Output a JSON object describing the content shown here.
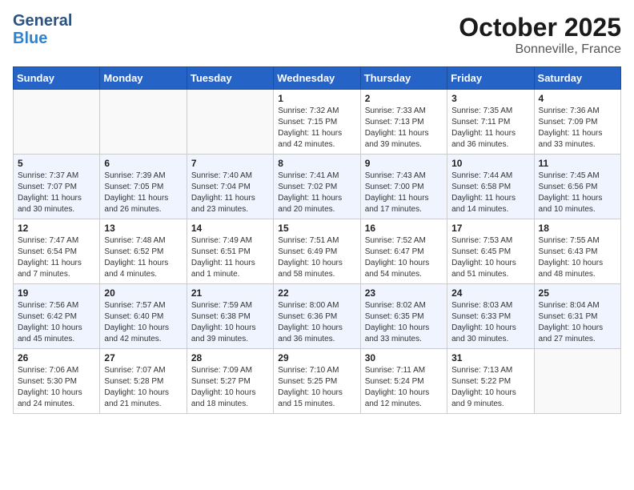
{
  "header": {
    "logo_line1": "General",
    "logo_line2": "Blue",
    "month": "October 2025",
    "location": "Bonneville, France"
  },
  "weekdays": [
    "Sunday",
    "Monday",
    "Tuesday",
    "Wednesday",
    "Thursday",
    "Friday",
    "Saturday"
  ],
  "weeks": [
    [
      {
        "day": "",
        "info": ""
      },
      {
        "day": "",
        "info": ""
      },
      {
        "day": "",
        "info": ""
      },
      {
        "day": "1",
        "info": "Sunrise: 7:32 AM\nSunset: 7:15 PM\nDaylight: 11 hours\nand 42 minutes."
      },
      {
        "day": "2",
        "info": "Sunrise: 7:33 AM\nSunset: 7:13 PM\nDaylight: 11 hours\nand 39 minutes."
      },
      {
        "day": "3",
        "info": "Sunrise: 7:35 AM\nSunset: 7:11 PM\nDaylight: 11 hours\nand 36 minutes."
      },
      {
        "day": "4",
        "info": "Sunrise: 7:36 AM\nSunset: 7:09 PM\nDaylight: 11 hours\nand 33 minutes."
      }
    ],
    [
      {
        "day": "5",
        "info": "Sunrise: 7:37 AM\nSunset: 7:07 PM\nDaylight: 11 hours\nand 30 minutes."
      },
      {
        "day": "6",
        "info": "Sunrise: 7:39 AM\nSunset: 7:05 PM\nDaylight: 11 hours\nand 26 minutes."
      },
      {
        "day": "7",
        "info": "Sunrise: 7:40 AM\nSunset: 7:04 PM\nDaylight: 11 hours\nand 23 minutes."
      },
      {
        "day": "8",
        "info": "Sunrise: 7:41 AM\nSunset: 7:02 PM\nDaylight: 11 hours\nand 20 minutes."
      },
      {
        "day": "9",
        "info": "Sunrise: 7:43 AM\nSunset: 7:00 PM\nDaylight: 11 hours\nand 17 minutes."
      },
      {
        "day": "10",
        "info": "Sunrise: 7:44 AM\nSunset: 6:58 PM\nDaylight: 11 hours\nand 14 minutes."
      },
      {
        "day": "11",
        "info": "Sunrise: 7:45 AM\nSunset: 6:56 PM\nDaylight: 11 hours\nand 10 minutes."
      }
    ],
    [
      {
        "day": "12",
        "info": "Sunrise: 7:47 AM\nSunset: 6:54 PM\nDaylight: 11 hours\nand 7 minutes."
      },
      {
        "day": "13",
        "info": "Sunrise: 7:48 AM\nSunset: 6:52 PM\nDaylight: 11 hours\nand 4 minutes."
      },
      {
        "day": "14",
        "info": "Sunrise: 7:49 AM\nSunset: 6:51 PM\nDaylight: 11 hours\nand 1 minute."
      },
      {
        "day": "15",
        "info": "Sunrise: 7:51 AM\nSunset: 6:49 PM\nDaylight: 10 hours\nand 58 minutes."
      },
      {
        "day": "16",
        "info": "Sunrise: 7:52 AM\nSunset: 6:47 PM\nDaylight: 10 hours\nand 54 minutes."
      },
      {
        "day": "17",
        "info": "Sunrise: 7:53 AM\nSunset: 6:45 PM\nDaylight: 10 hours\nand 51 minutes."
      },
      {
        "day": "18",
        "info": "Sunrise: 7:55 AM\nSunset: 6:43 PM\nDaylight: 10 hours\nand 48 minutes."
      }
    ],
    [
      {
        "day": "19",
        "info": "Sunrise: 7:56 AM\nSunset: 6:42 PM\nDaylight: 10 hours\nand 45 minutes."
      },
      {
        "day": "20",
        "info": "Sunrise: 7:57 AM\nSunset: 6:40 PM\nDaylight: 10 hours\nand 42 minutes."
      },
      {
        "day": "21",
        "info": "Sunrise: 7:59 AM\nSunset: 6:38 PM\nDaylight: 10 hours\nand 39 minutes."
      },
      {
        "day": "22",
        "info": "Sunrise: 8:00 AM\nSunset: 6:36 PM\nDaylight: 10 hours\nand 36 minutes."
      },
      {
        "day": "23",
        "info": "Sunrise: 8:02 AM\nSunset: 6:35 PM\nDaylight: 10 hours\nand 33 minutes."
      },
      {
        "day": "24",
        "info": "Sunrise: 8:03 AM\nSunset: 6:33 PM\nDaylight: 10 hours\nand 30 minutes."
      },
      {
        "day": "25",
        "info": "Sunrise: 8:04 AM\nSunset: 6:31 PM\nDaylight: 10 hours\nand 27 minutes."
      }
    ],
    [
      {
        "day": "26",
        "info": "Sunrise: 7:06 AM\nSunset: 5:30 PM\nDaylight: 10 hours\nand 24 minutes."
      },
      {
        "day": "27",
        "info": "Sunrise: 7:07 AM\nSunset: 5:28 PM\nDaylight: 10 hours\nand 21 minutes."
      },
      {
        "day": "28",
        "info": "Sunrise: 7:09 AM\nSunset: 5:27 PM\nDaylight: 10 hours\nand 18 minutes."
      },
      {
        "day": "29",
        "info": "Sunrise: 7:10 AM\nSunset: 5:25 PM\nDaylight: 10 hours\nand 15 minutes."
      },
      {
        "day": "30",
        "info": "Sunrise: 7:11 AM\nSunset: 5:24 PM\nDaylight: 10 hours\nand 12 minutes."
      },
      {
        "day": "31",
        "info": "Sunrise: 7:13 AM\nSunset: 5:22 PM\nDaylight: 10 hours\nand 9 minutes."
      },
      {
        "day": "",
        "info": ""
      }
    ]
  ]
}
